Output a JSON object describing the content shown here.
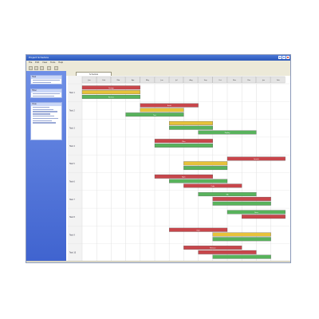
{
  "window": {
    "title": "Project Schedule"
  },
  "menu": [
    "File",
    "Edit",
    "View",
    "Tools",
    "Help"
  ],
  "sidebar": {
    "panels": [
      {
        "title": "Task",
        "lines": 2
      },
      {
        "title": "Filter",
        "lines": 2
      },
      {
        "title": "View",
        "lines": 8
      }
    ]
  },
  "tab": {
    "label": "Schedule"
  },
  "gantt": {
    "columns": [
      "Jan",
      "Feb",
      "Mar",
      "Apr",
      "May",
      "Jun",
      "Jul",
      "Aug",
      "Sep",
      "Oct",
      "Nov",
      "Dec",
      "Jan",
      "Feb"
    ],
    "rows": [
      {
        "label": "Task 1",
        "bars": [
          {
            "start": 0.0,
            "end": 4.0,
            "color": "#c8464b",
            "lane": 0,
            "text": "Design"
          },
          {
            "start": 0.0,
            "end": 4.0,
            "color": "#e7c23a",
            "lane": 1,
            "text": ""
          },
          {
            "start": 0.0,
            "end": 4.0,
            "color": "#58b35c",
            "lane": 2,
            "text": "Review"
          }
        ]
      },
      {
        "label": "Task 2",
        "bars": [
          {
            "start": 4.0,
            "end": 8.0,
            "color": "#c8464b",
            "lane": 0,
            "text": "Build"
          },
          {
            "start": 4.0,
            "end": 7.0,
            "color": "#e7c23a",
            "lane": 1,
            "text": ""
          },
          {
            "start": 3.0,
            "end": 7.0,
            "color": "#58b35c",
            "lane": 2,
            "text": "Test"
          }
        ]
      },
      {
        "label": "Task 3",
        "bars": [
          {
            "start": 6.0,
            "end": 9.0,
            "color": "#e7c23a",
            "lane": 0,
            "text": ""
          },
          {
            "start": 6.0,
            "end": 9.0,
            "color": "#58b35c",
            "lane": 1,
            "text": ""
          },
          {
            "start": 8.0,
            "end": 12.0,
            "color": "#58b35c",
            "lane": 2,
            "text": "Deploy"
          }
        ]
      },
      {
        "label": "Task 4",
        "bars": [
          {
            "start": 5.0,
            "end": 9.0,
            "color": "#c8464b",
            "lane": 0,
            "text": "Plan"
          },
          {
            "start": 5.0,
            "end": 9.0,
            "color": "#58b35c",
            "lane": 1,
            "text": ""
          }
        ]
      },
      {
        "label": "Task 5",
        "bars": [
          {
            "start": 10.0,
            "end": 14.0,
            "color": "#c8464b",
            "lane": 0,
            "text": "Launch"
          },
          {
            "start": 7.0,
            "end": 10.0,
            "color": "#e7c23a",
            "lane": 1,
            "text": ""
          },
          {
            "start": 7.0,
            "end": 10.0,
            "color": "#58b35c",
            "lane": 2,
            "text": ""
          }
        ]
      },
      {
        "label": "Task 6",
        "bars": [
          {
            "start": 5.0,
            "end": 9.0,
            "color": "#c8464b",
            "lane": 0,
            "text": "Spec"
          },
          {
            "start": 6.0,
            "end": 10.0,
            "color": "#58b35c",
            "lane": 1,
            "text": ""
          },
          {
            "start": 7.0,
            "end": 11.0,
            "color": "#c8464b",
            "lane": 2,
            "text": "Code"
          }
        ]
      },
      {
        "label": "Task 7",
        "bars": [
          {
            "start": 8.0,
            "end": 12.0,
            "color": "#58b35c",
            "lane": 0,
            "text": "QA"
          },
          {
            "start": 9.0,
            "end": 13.0,
            "color": "#c8464b",
            "lane": 1,
            "text": ""
          },
          {
            "start": 9.0,
            "end": 13.0,
            "color": "#58b35c",
            "lane": 2,
            "text": ""
          }
        ]
      },
      {
        "label": "Task 8",
        "bars": [
          {
            "start": 10.0,
            "end": 14.0,
            "color": "#58b35c",
            "lane": 0,
            "text": "Docs"
          },
          {
            "start": 11.0,
            "end": 14.0,
            "color": "#c8464b",
            "lane": 1,
            "text": ""
          }
        ]
      },
      {
        "label": "Task 9",
        "bars": [
          {
            "start": 6.0,
            "end": 10.0,
            "color": "#c8464b",
            "lane": 0,
            "text": "Train"
          },
          {
            "start": 9.0,
            "end": 13.0,
            "color": "#e7c23a",
            "lane": 1,
            "text": ""
          },
          {
            "start": 9.0,
            "end": 13.0,
            "color": "#58b35c",
            "lane": 2,
            "text": ""
          }
        ]
      },
      {
        "label": "Task 10",
        "bars": [
          {
            "start": 7.0,
            "end": 11.0,
            "color": "#c8464b",
            "lane": 0,
            "text": "Release"
          },
          {
            "start": 8.0,
            "end": 12.0,
            "color": "#c8464b",
            "lane": 1,
            "text": ""
          },
          {
            "start": 9.0,
            "end": 13.0,
            "color": "#58b35c",
            "lane": 2,
            "text": ""
          }
        ]
      }
    ]
  }
}
